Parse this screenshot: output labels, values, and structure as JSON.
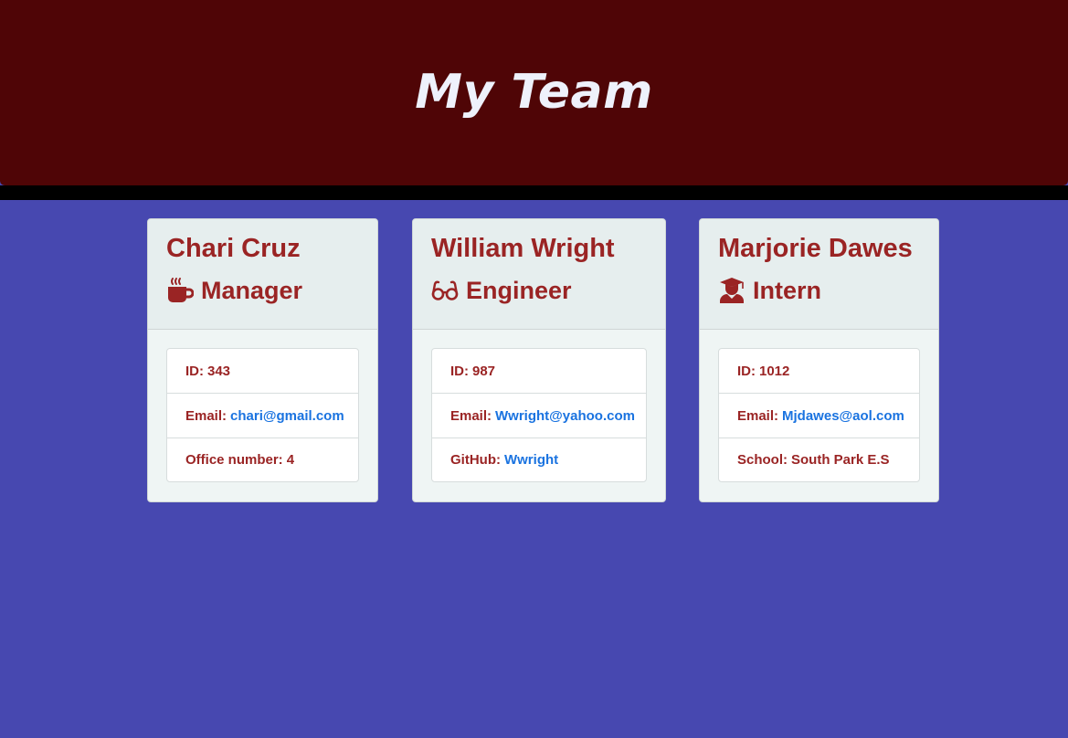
{
  "header": {
    "title": "My Team"
  },
  "colors": {
    "header_bg": "#4f0506",
    "page_bg": "#4748b0",
    "accent_text": "#9a2424",
    "link": "#1a73e0"
  },
  "cards": [
    {
      "name": "Chari Cruz",
      "role": "Manager",
      "role_icon": "coffee-mug-icon",
      "id_label": "ID:",
      "id_value": "343",
      "email_label": "Email:",
      "email_value": "chari@gmail.com",
      "extra_label": "Office number:",
      "extra_value": "4"
    },
    {
      "name": "William Wright",
      "role": "Engineer",
      "role_icon": "glasses-icon",
      "id_label": "ID:",
      "id_value": "987",
      "email_label": "Email:",
      "email_value": "Wwright@yahoo.com",
      "extra_label": "GitHub:",
      "extra_value": "Wwright"
    },
    {
      "name": "Marjorie Dawes",
      "role": "Intern",
      "role_icon": "graduate-icon",
      "id_label": "ID:",
      "id_value": "1012",
      "email_label": "Email:",
      "email_value": "Mjdawes@aol.com",
      "extra_label": "School:",
      "extra_value": "South Park E.S"
    }
  ]
}
